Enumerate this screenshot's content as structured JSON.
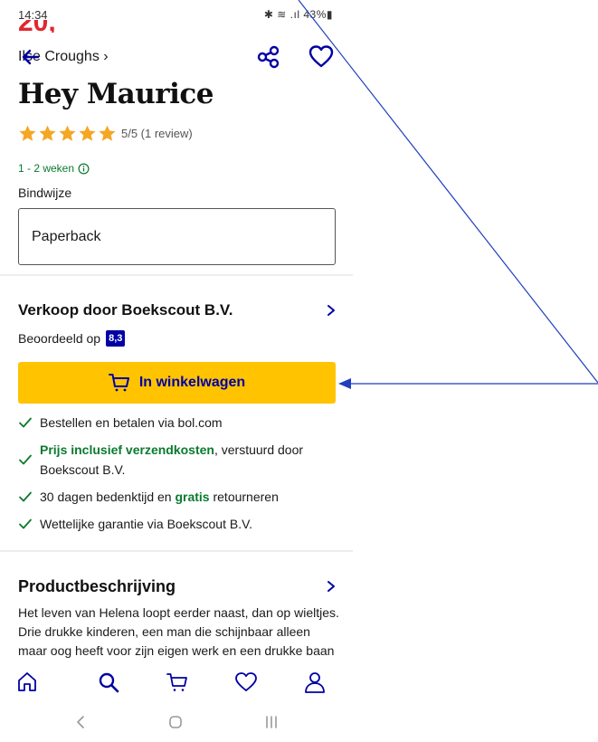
{
  "status": {
    "time": "14:34",
    "indicators": "✱ ≋ ᵛᵒˡᵗᴱ .ıl 43%▮",
    "battery": "43%"
  },
  "price_peek": "20,",
  "topbar": {
    "author": "Ilse Croughs",
    "author_chevron": "›",
    "back_icon": "arrow-left-icon",
    "share_icon": "share-icon",
    "favorite_icon": "heart-icon"
  },
  "product": {
    "title": "Hey Maurice",
    "rating_value": 5,
    "rating_text": "5/5 (1 review)",
    "delivery": "1 - 2 weken",
    "binding_label": "Bindwijze",
    "binding_value": "Paperback"
  },
  "seller": {
    "name": "Verkoop door Boekscout B.V.",
    "rated_label": "Beoordeeld op",
    "score": "8,3"
  },
  "cart_button": "In winkelwagen",
  "benefits": [
    {
      "pre": "Bestellen en betalen via bol.com",
      "bold": "",
      "post": ""
    },
    {
      "pre": "",
      "bold": "Prijs inclusief verzendkosten",
      "post": ", verstuurd door Boekscout B.V."
    },
    {
      "pre": "30 dagen bedenktijd en ",
      "bold": "gratis",
      "post": " retourneren"
    },
    {
      "pre": "Wettelijke garantie via Boekscout B.V.",
      "bold": "",
      "post": ""
    }
  ],
  "description": {
    "title": "Productbeschrijving",
    "text": "Het leven van Helena loopt eerder naast, dan op wieltjes. Drie drukke kinderen, een man die schijnbaar alleen maar oog heeft voor zijn eigen werk en een drukke baan bij de gemeente..."
  },
  "tabbar": [
    "home-icon",
    "search-icon",
    "cart-icon",
    "heart-icon",
    "user-icon"
  ],
  "navbar": [
    "back-nav-icon",
    "home-nav-icon",
    "recents-nav-icon"
  ],
  "colors": {
    "brand_blue": "#0000a4",
    "cart_yellow": "#ffc300",
    "green": "#0a7a2f",
    "star": "#f5a623",
    "price_red": "#e0282f",
    "annotation": "#1f3fbf"
  }
}
